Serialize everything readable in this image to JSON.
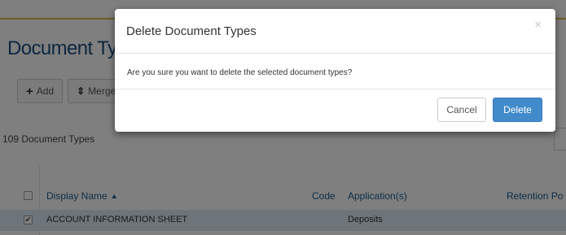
{
  "page": {
    "title": "Document Types",
    "toolbar": {
      "add_icon": "plus-icon",
      "add_label": "Add",
      "merge_icon": "merge-arrows-icon",
      "merge_label": "Merge"
    },
    "count_label": "109 Document Types",
    "grid": {
      "columns": [
        "Display Name",
        "Code",
        "Application(s)",
        "Retention Po"
      ],
      "sort_column": "Display Name",
      "sort_direction": "ascending",
      "rows": [
        {
          "checked": true,
          "display_name": "ACCOUNT INFORMATION SHEET",
          "code": "",
          "applications": "Deposits",
          "retention": ""
        }
      ]
    }
  },
  "modal": {
    "title": "Delete Document Types",
    "close_symbol": "×",
    "message": "Are you sure you want to delete the selected document types?",
    "cancel_label": "Cancel",
    "delete_label": "Delete"
  },
  "colors": {
    "primary_button": "#428bca",
    "title_blue": "#1b4e7e",
    "selected_row": "#dbe8f4"
  }
}
